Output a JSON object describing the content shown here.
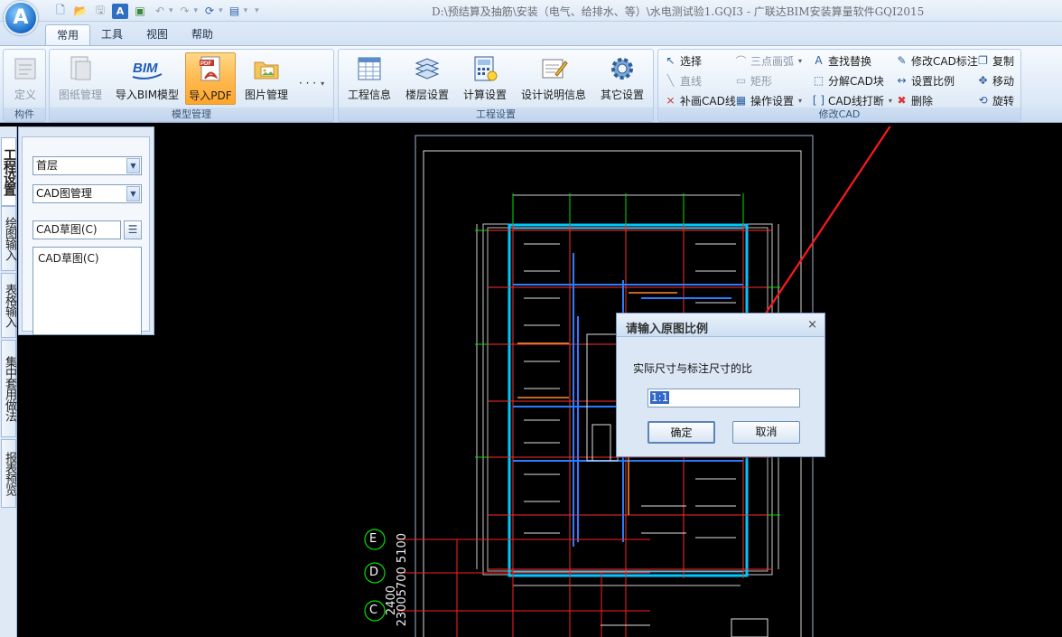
{
  "app": {
    "logo_letter": "A",
    "title": "D:\\预结算及抽筋\\安装（电气、给排水、等）\\水电测试验1.GQI3 - 广联达BIM安装算量软件GQI2015"
  },
  "tabs": [
    {
      "label": "常用",
      "active": true
    },
    {
      "label": "工具",
      "active": false
    },
    {
      "label": "视图",
      "active": false
    },
    {
      "label": "帮助",
      "active": false
    }
  ],
  "ribbon": {
    "group1": {
      "label": "构件",
      "buttons": [
        {
          "label": "定义",
          "icon": "define-icon",
          "enabled": false
        }
      ]
    },
    "group2": {
      "label": "模型管理",
      "buttons": [
        {
          "label": "图纸管理",
          "icon": "drawing-manage-icon",
          "enabled": false
        },
        {
          "label": "导入BIM模型",
          "icon": "bim-icon",
          "enabled": true,
          "icon_text": "BIM"
        },
        {
          "label": "导入PDF",
          "icon": "pdf-icon",
          "enabled": true,
          "active": true,
          "icon_text": "PDF"
        },
        {
          "label": "图片管理",
          "icon": "folder-image-icon",
          "enabled": true
        }
      ],
      "more": "· · ·"
    },
    "group3": {
      "label": "工程设置",
      "buttons": [
        {
          "label": "工程信息",
          "icon": "project-info-icon"
        },
        {
          "label": "楼层设置",
          "icon": "floor-settings-icon"
        },
        {
          "label": "计算设置",
          "icon": "calc-settings-icon"
        },
        {
          "label": "设计说明信息",
          "icon": "design-notes-icon"
        },
        {
          "label": "其它设置",
          "icon": "gear-icon"
        }
      ]
    },
    "group4": {
      "label": "修改CAD",
      "col1": [
        {
          "label": "选择",
          "icon": "select-arrow-icon",
          "enabled": true
        },
        {
          "label": "直线",
          "icon": "line-icon",
          "enabled": false
        },
        {
          "label": "补画CAD线",
          "icon": "cad-line-icon",
          "enabled": true
        }
      ],
      "col2": [
        {
          "label": "三点画弧",
          "icon": "arc-icon",
          "enabled": false
        },
        {
          "label": "矩形",
          "icon": "rectangle-icon",
          "enabled": false
        },
        {
          "label": "操作设置",
          "icon": "operation-settings-icon",
          "enabled": true
        }
      ],
      "col3": [
        {
          "label": "查找替换",
          "icon": "find-replace-icon"
        },
        {
          "label": "分解CAD块",
          "icon": "explode-block-icon"
        },
        {
          "label": "CAD线打断",
          "icon": "break-line-icon"
        }
      ],
      "col4": [
        {
          "label": "修改CAD标注",
          "icon": "edit-dimension-icon"
        },
        {
          "label": "设置比例",
          "icon": "set-scale-icon"
        },
        {
          "label": "删除",
          "icon": "delete-icon"
        }
      ],
      "col5": [
        {
          "label": "复制",
          "icon": "copy-icon"
        },
        {
          "label": "移动",
          "icon": "move-icon"
        },
        {
          "label": "旋转",
          "icon": "rotate-icon"
        }
      ]
    }
  },
  "left_tabs": [
    "工程设置",
    "绘图输入",
    "表格输入",
    "集中套用做法",
    "报表预览"
  ],
  "panel": {
    "floor_select": "首层",
    "mode_select": "CAD图管理",
    "drawing_input": "CAD草图(C)",
    "list_items": [
      "CAD草图(C)"
    ]
  },
  "cad": {
    "axis_labels": [
      "E",
      "D",
      "C"
    ],
    "dimension_text": "23005700 5100",
    "dimension_text2": "2400",
    "colors": {
      "background": "#000000",
      "wall": "#00c8ff",
      "grid": "#ff2020",
      "frame": "#ffffff"
    }
  },
  "dialog": {
    "title": "请输入原图比例",
    "close": "×",
    "prompt": "实际尺寸与标注尺寸的比",
    "value": "1:1",
    "ok_label": "确定",
    "cancel_label": "取消"
  }
}
